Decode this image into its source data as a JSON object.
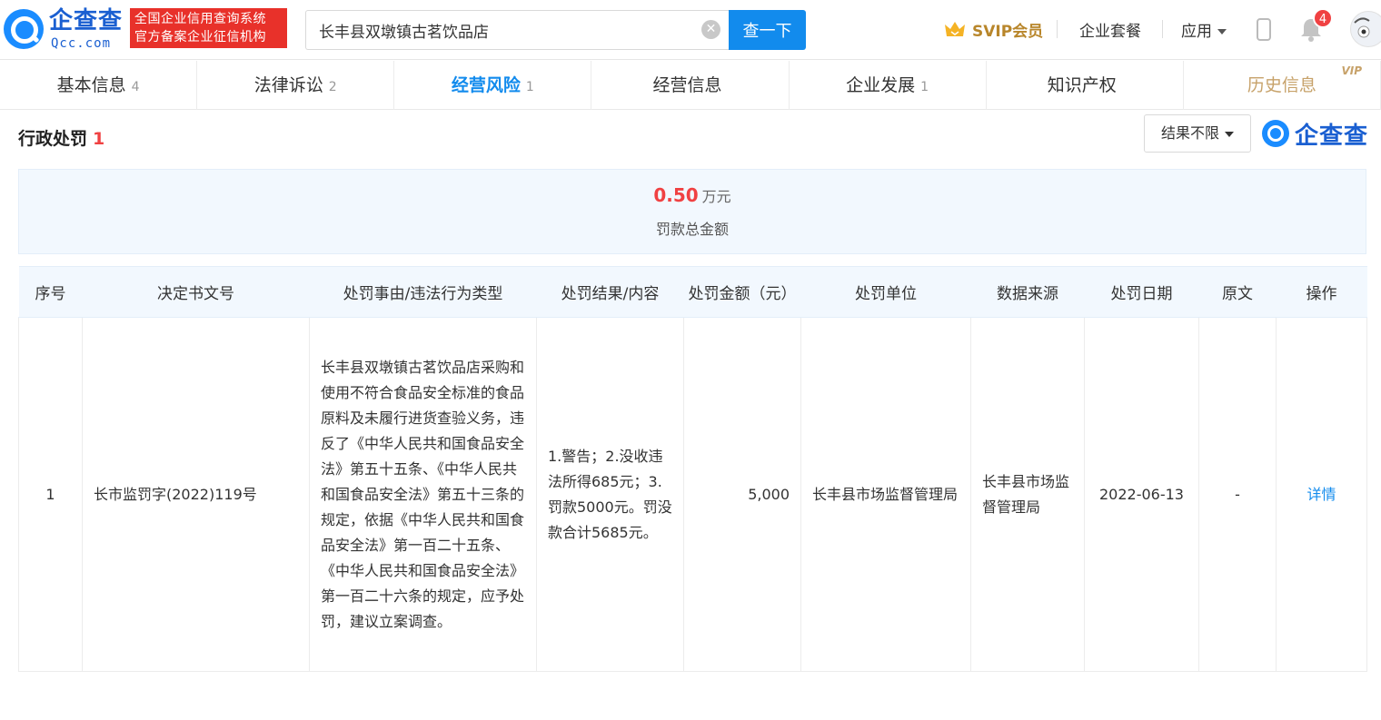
{
  "header": {
    "logo_name": "企查查",
    "logo_sub": "Qcc.com",
    "slogan_line1": "全国企业信用查询系统",
    "slogan_line2": "官方备案企业征信机构",
    "search_value": "长丰县双墩镇古茗饮品店",
    "search_button": "查一下",
    "svip_label": "SVIP会员",
    "nav_package": "企业套餐",
    "nav_apps": "应用",
    "notification_count": "4"
  },
  "tabs": [
    {
      "label": "基本信息",
      "count": "4"
    },
    {
      "label": "法律诉讼",
      "count": "2"
    },
    {
      "label": "经营风险",
      "count": "1"
    },
    {
      "label": "经营信息",
      "count": ""
    },
    {
      "label": "企业发展",
      "count": "1"
    },
    {
      "label": "知识产权",
      "count": ""
    },
    {
      "label": "历史信息",
      "count": "",
      "tag": "VIP"
    }
  ],
  "section": {
    "title": "行政处罚",
    "count": "1",
    "filter_label": "结果不限",
    "brand": "企查查"
  },
  "summary": {
    "value": "0.50",
    "unit": "万元",
    "label": "罚款总金额"
  },
  "table": {
    "headers": [
      "序号",
      "决定书文号",
      "处罚事由/违法行为类型",
      "处罚结果/内容",
      "处罚金额（元）",
      "处罚单位",
      "数据来源",
      "处罚日期",
      "原文",
      "操作"
    ],
    "rows": [
      {
        "index": "1",
        "doc_no": "长市监罚字(2022)119号",
        "reason": "长丰县双墩镇古茗饮品店采购和使用不符合食品安全标准的食品原料及未履行进货查验义务，违反了《中华人民共和国食品安全法》第五十五条、《中华人民共和国食品安全法》第五十三条的规定，依据《中华人民共和国食品安全法》第一百二十五条、《中华人民共和国食品安全法》第一百二十六条的规定，应予处罚，建议立案调查。",
        "result": "1.警告；2.没收违法所得685元；3.罚款5000元。罚没款合计5685元。",
        "amount": "5,000",
        "unit": "长丰县市场监督管理局",
        "source": "长丰县市场监督管理局",
        "date": "2022-06-13",
        "original": "-",
        "action": "详情"
      }
    ]
  },
  "colors": {
    "primary": "#128bed",
    "danger": "#f04142",
    "gold": "#c7a26a",
    "summary_bg": "#f2f8fe"
  }
}
